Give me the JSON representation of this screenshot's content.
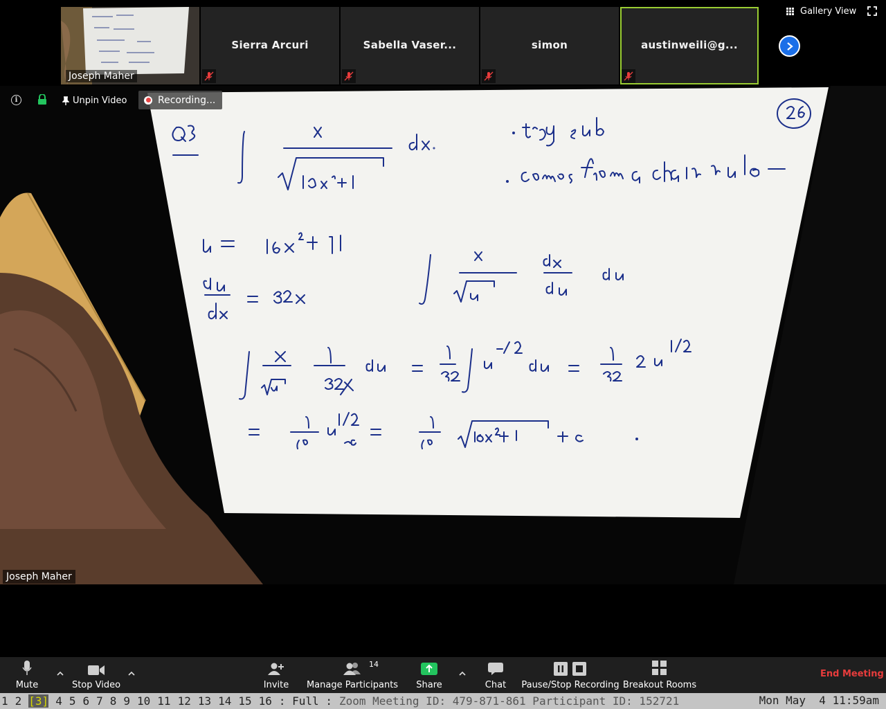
{
  "gallery_view_label": "Gallery View",
  "participants": [
    {
      "name": "Joseph Maher",
      "muted": false,
      "video": true
    },
    {
      "name": "Sierra Arcuri",
      "muted": true,
      "video": false
    },
    {
      "name": "Sabella Vaser...",
      "muted": true,
      "video": false
    },
    {
      "name": "simon",
      "muted": true,
      "video": false
    },
    {
      "name": "austinweili@g...",
      "muted": true,
      "video": false,
      "active": true
    }
  ],
  "overlay": {
    "unpin_label": "Unpin Video",
    "recording_label": "Recording..."
  },
  "active_speaker": "Joseph Maher",
  "toolbar": {
    "mute": "Mute",
    "stop_video": "Stop Video",
    "invite": "Invite",
    "manage_participants": "Manage Participants",
    "participant_count": "14",
    "share": "Share",
    "chat": "Chat",
    "pause_stop_recording": "Pause/Stop Recording",
    "breakout_rooms": "Breakout Rooms",
    "end_meeting": "End Meeting"
  },
  "statusline": {
    "workspaces": [
      "1",
      "2",
      "[3]",
      "4",
      "5",
      "6",
      "7",
      "8",
      "9",
      "10",
      "11",
      "12",
      "13",
      "14",
      "15",
      "16"
    ],
    "current_workspace": "[3]",
    "layout": ": Full :",
    "title": "Zoom Meeting ID: 479-871-861 Participant ID: 152721",
    "clock": "Mon May  4 11:59am"
  },
  "colors": {
    "active_border": "#9acd32",
    "end_meeting": "#e83c3c",
    "share_green": "#23c45e",
    "next_blue": "#1b6fe8",
    "ink": "#1b2f8a",
    "paper": "#f3f3f0"
  }
}
